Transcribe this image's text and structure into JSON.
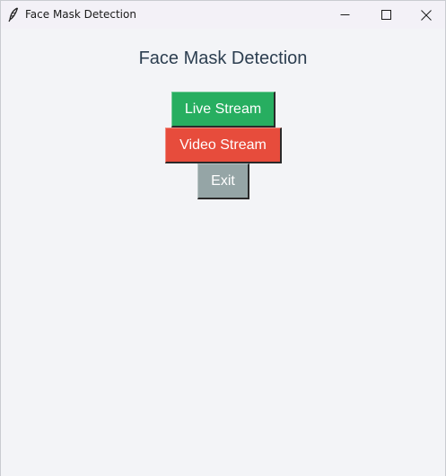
{
  "window": {
    "title": "Face Mask Detection",
    "app_icon": "feather-icon",
    "controls": {
      "minimize_icon": "minimize-icon",
      "maximize_icon": "maximize-icon",
      "close_icon": "close-icon"
    }
  },
  "main": {
    "heading": "Face Mask Detection",
    "buttons": {
      "live_stream": {
        "label": "Live Stream",
        "color": "#27ae60"
      },
      "video_stream": {
        "label": "Video Stream",
        "color": "#e74c3c"
      },
      "exit": {
        "label": "Exit",
        "color": "#95a5a6"
      }
    }
  },
  "colors": {
    "background": "#f3f4f7",
    "heading": "#2c3e50",
    "button_text": "#ffffff"
  }
}
